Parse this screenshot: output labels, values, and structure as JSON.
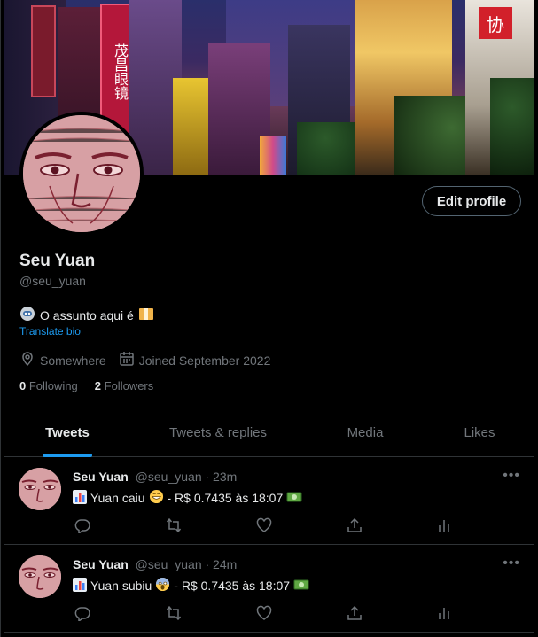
{
  "profile": {
    "name": "Seu Yuan",
    "handle": "@seu_yuan",
    "edit_label": "Edit profile",
    "bio_text": "O assunto aqui é",
    "translate_label": "Translate bio",
    "location": "Somewhere",
    "joined": "Joined September 2022",
    "following_count": "0",
    "following_label": "Following",
    "followers_count": "2",
    "followers_label": "Followers",
    "banner_signs": [
      "茂昌眼镜",
      "协"
    ]
  },
  "tabs": [
    "Tweets",
    "Tweets & replies",
    "Media",
    "Likes"
  ],
  "tweets": [
    {
      "name": "Seu Yuan",
      "handle": "@seu_yuan",
      "time": "· 23m",
      "text_a": "Yuan caiu",
      "text_b": "- R$ 0.7435 às 18:07"
    },
    {
      "name": "Seu Yuan",
      "handle": "@seu_yuan",
      "time": "· 24m",
      "text_a": "Yuan subiu",
      "text_b": "- R$ 0.7435 às 18:07"
    }
  ],
  "colors": {
    "accent": "#1d9bf0",
    "muted": "#71767b",
    "border": "#2f3336"
  },
  "icons": [
    "chart-icon",
    "grinning-icon",
    "scream-icon",
    "money-icon",
    "reply-icon",
    "retweet-icon",
    "like-icon",
    "share-icon",
    "analytics-icon",
    "location-icon",
    "calendar-icon",
    "more-icon"
  ]
}
